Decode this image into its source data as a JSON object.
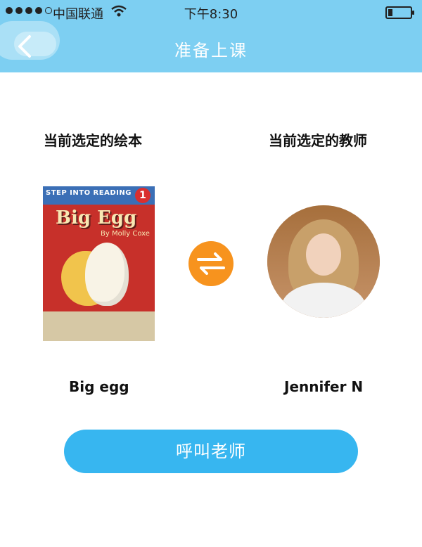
{
  "status_bar": {
    "carrier": "中国联通",
    "time": "下午8:30",
    "signal_bars_filled": 4,
    "signal_bars_total": 5,
    "battery_level_fraction": 0.15
  },
  "header": {
    "title": "准备上课",
    "back_icon": "chevron-left-icon"
  },
  "book": {
    "section_label": "当前选定的绘本",
    "name": "Big  egg",
    "cover": {
      "series": "STEP INTO READING",
      "level": "1",
      "title": "Big Egg",
      "author": "By Molly Coxe"
    }
  },
  "teacher": {
    "section_label": "当前选定的教师",
    "name": "Jennifer  N"
  },
  "swap_icon": "swap-arrows-icon",
  "call_button": {
    "label": "呼叫老师"
  },
  "colors": {
    "header_bg": "#7dcff2",
    "swap_button": "#f7931e",
    "call_button": "#37b6f0"
  }
}
